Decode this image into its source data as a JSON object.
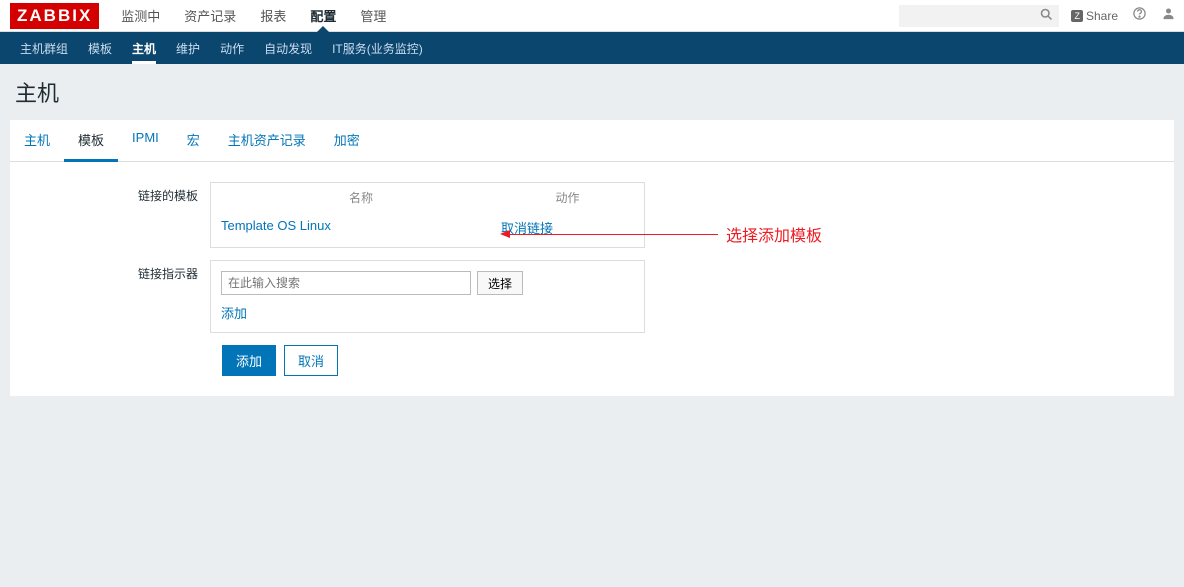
{
  "logo": "ZABBIX",
  "topMenu": {
    "items": [
      "监测中",
      "资产记录",
      "报表",
      "配置",
      "管理"
    ],
    "activeIndex": 3
  },
  "topRight": {
    "shareLabel": "Share",
    "shareBadge": "Z"
  },
  "subMenu": {
    "items": [
      "主机群组",
      "模板",
      "主机",
      "维护",
      "动作",
      "自动发现",
      "IT服务(业务监控)"
    ],
    "activeIndex": 2
  },
  "pageTitle": "主机",
  "tabs": {
    "items": [
      "主机",
      "模板",
      "IPMI",
      "宏",
      "主机资产记录",
      "加密"
    ],
    "activeIndex": 1
  },
  "form": {
    "linkedTemplates": {
      "label": "链接的模板",
      "headerName": "名称",
      "headerAction": "动作",
      "rows": [
        {
          "name": "Template OS Linux",
          "action": "取消链接"
        }
      ]
    },
    "linkIndicator": {
      "label": "链接指示器",
      "searchPlaceholder": "在此输入搜索",
      "selectBtn": "选择",
      "addLink": "添加"
    },
    "buttons": {
      "submit": "添加",
      "cancel": "取消"
    }
  },
  "annotation": "选择添加模板"
}
